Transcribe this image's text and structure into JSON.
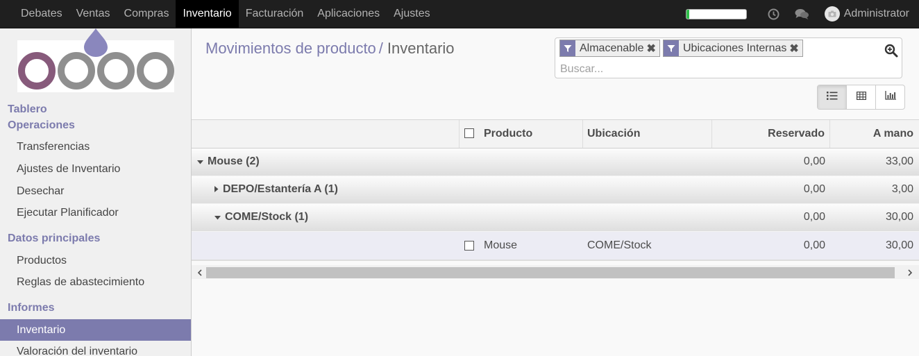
{
  "topbar": {
    "menu": [
      "Debates",
      "Ventas",
      "Compras",
      "Inventario",
      "Facturación",
      "Aplicaciones",
      "Ajustes"
    ],
    "active_menu": "Inventario",
    "progress_fraction": 0.05,
    "user": "Administrator"
  },
  "sidebar": {
    "logo_text": "odoo",
    "sections": {
      "tablero": "Tablero",
      "operaciones": "Operaciones",
      "datos": "Datos principales",
      "informes": "Informes"
    },
    "items": {
      "transferencias": "Transferencias",
      "ajustes": "Ajustes de Inventario",
      "desechar": "Desechar",
      "planificador": "Ejecutar Planificador",
      "productos": "Productos",
      "reglas": "Reglas de abastecimiento",
      "inventario": "Inventario",
      "valoracion": "Valoración del inventario"
    }
  },
  "breadcrumb": {
    "parent": "Movimientos de producto",
    "separator": "/",
    "current": "Inventario"
  },
  "search": {
    "facets": [
      "Almacenable",
      "Ubicaciones Internas"
    ],
    "placeholder": "Buscar..."
  },
  "table": {
    "columns": {
      "producto": "Producto",
      "ubicacion": "Ubicación",
      "reservado": "Reservado",
      "a_mano": "A mano"
    },
    "groups": [
      {
        "label": "Mouse (2)",
        "reservado": "0,00",
        "a_mano": "33,00"
      },
      {
        "label": "DEPO/Estantería A (1)",
        "reservado": "0,00",
        "a_mano": "3,00"
      },
      {
        "label": "COME/Stock (1)",
        "reservado": "0,00",
        "a_mano": "30,00"
      }
    ],
    "rows": [
      {
        "producto": "Mouse",
        "ubicacion": "COME/Stock",
        "reservado": "0,00",
        "a_mano": "30,00"
      }
    ]
  },
  "colors": {
    "accent": "#7c7bad",
    "topbar": "#1f1f1f",
    "logo_purple": "#875a7b",
    "logo_grey": "#8f8f8f"
  }
}
